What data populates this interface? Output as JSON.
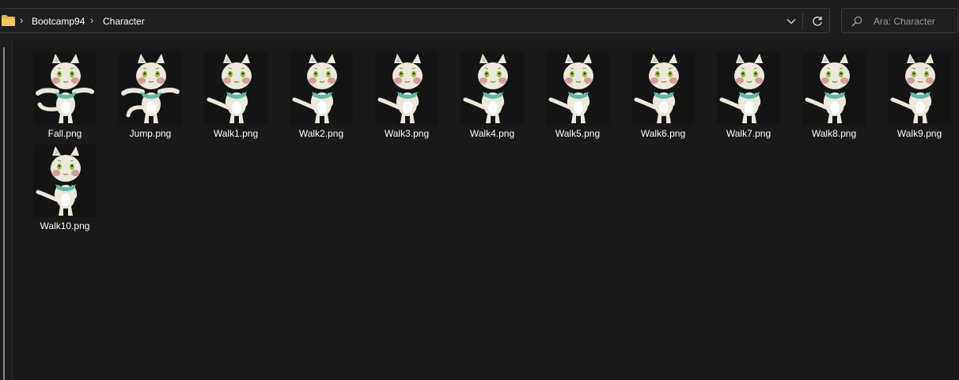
{
  "breadcrumb": {
    "folder_icon": "folder-icon",
    "items": [
      "Bootcamp94",
      "Character"
    ]
  },
  "address_bar": {
    "dropdown_icon": "chevron-down-icon",
    "refresh_icon": "refresh-icon"
  },
  "search": {
    "placeholder": "Ara: Character",
    "icon": "search-icon"
  },
  "files": [
    {
      "name": "Fall.png",
      "pose": "fall"
    },
    {
      "name": "Jump.png",
      "pose": "jump"
    },
    {
      "name": "Walk1.png",
      "pose": "walk"
    },
    {
      "name": "Walk2.png",
      "pose": "walk"
    },
    {
      "name": "Walk3.png",
      "pose": "walk"
    },
    {
      "name": "Walk4.png",
      "pose": "walk"
    },
    {
      "name": "Walk5.png",
      "pose": "walk"
    },
    {
      "name": "Walk6.png",
      "pose": "walk"
    },
    {
      "name": "Walk7.png",
      "pose": "walk"
    },
    {
      "name": "Walk8.png",
      "pose": "walk"
    },
    {
      "name": "Walk9.png",
      "pose": "walk"
    },
    {
      "name": "Walk10.png",
      "pose": "walk"
    }
  ],
  "colors": {
    "background": "#191919",
    "folder": "#e8b84a",
    "cat_fur": "#ece8dc",
    "cat_shadow": "#c9c3b3",
    "scarf": "#5fb9a8",
    "cheek": "#c98b8b",
    "eye": "#8fbf3a"
  }
}
